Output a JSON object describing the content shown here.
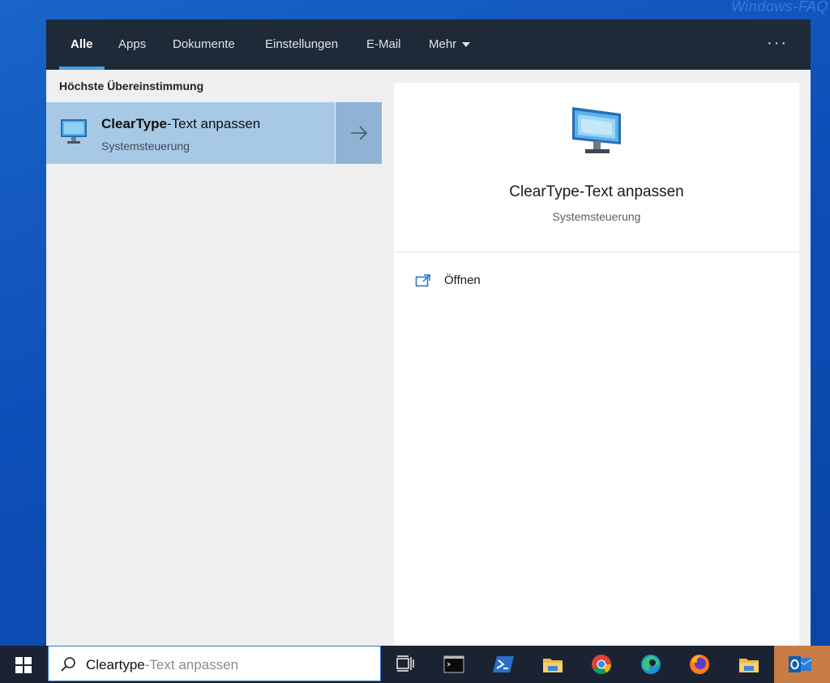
{
  "watermark": "Windows-FAQ",
  "nav": {
    "tabs": [
      {
        "label": "Alle",
        "active": true
      },
      {
        "label": "Apps"
      },
      {
        "label": "Dokumente"
      },
      {
        "label": "Einstellungen"
      },
      {
        "label": "E-Mail"
      },
      {
        "label": "Mehr"
      }
    ],
    "more_dots": "···"
  },
  "left": {
    "section_title": "Höchste Übereinstimmung",
    "best_match": {
      "title_bold": "ClearType",
      "title_rest": "-Text anpassen",
      "subtitle": "Systemsteuerung",
      "icon": "monitor-icon"
    }
  },
  "detail": {
    "title": "ClearType-Text anpassen",
    "subtitle": "Systemsteuerung",
    "icon": "monitor-icon",
    "actions": [
      {
        "label": "Öffnen",
        "icon": "open-icon"
      }
    ]
  },
  "taskbar": {
    "search_typed": "Cleartype",
    "search_suggestion": "-Text anpassen",
    "icons": [
      "windows-start-icon",
      "search-icon",
      "task-view-icon",
      "cmd-icon",
      "powershell-icon",
      "file-explorer-icon",
      "chrome-icon",
      "edge-icon",
      "firefox-icon",
      "file-explorer-icon",
      "outlook-icon"
    ]
  },
  "colors": {
    "accent": "#4b9ce2",
    "nav_bg": "#1f2a38",
    "selected_bg": "#a8c9e6",
    "taskbar_bg": "#1b2333"
  }
}
